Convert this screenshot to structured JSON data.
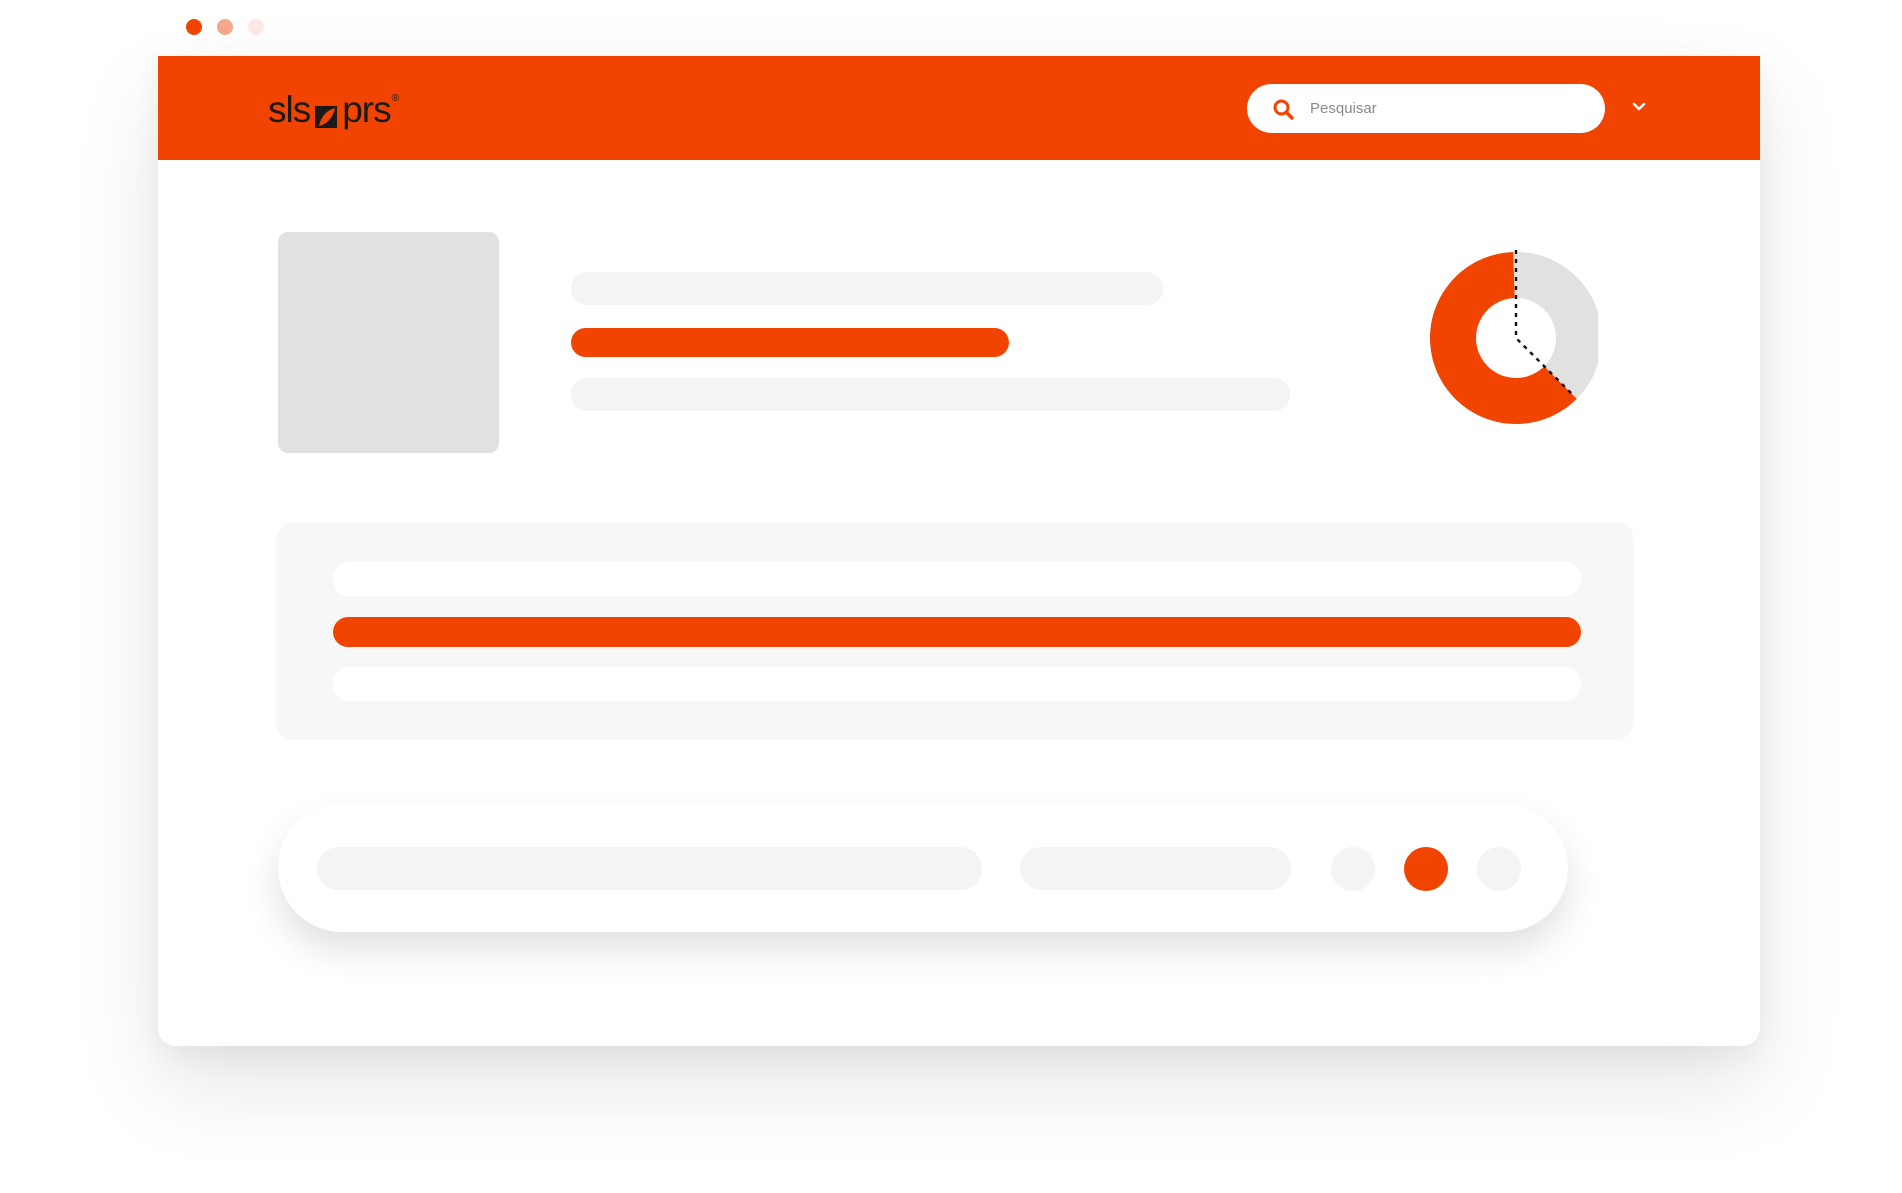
{
  "window_controls": [
    {
      "name": "close",
      "color": "#F04400"
    },
    {
      "name": "minimize",
      "color": "#F5A88E"
    },
    {
      "name": "maximize",
      "color": "#FDE9E3"
    }
  ],
  "header": {
    "background": "#F04400",
    "logo": {
      "prefix": "sls",
      "suffix": "prs",
      "trademark": "®"
    },
    "search": {
      "placeholder": "Pesquisar",
      "icon": "search-icon"
    },
    "menu_icon": "chevron-down-icon"
  },
  "colors": {
    "accent": "#F04400",
    "placeholder_light": "#F4F4F4",
    "placeholder_gray": "#E1E1E1",
    "panel": "#F7F7F7"
  },
  "donut": {
    "accent_share": 0.62,
    "remaining_share": 0.38,
    "annotation": "dashed-divider"
  },
  "pagination": {
    "pages": 3,
    "active_index": 1
  }
}
